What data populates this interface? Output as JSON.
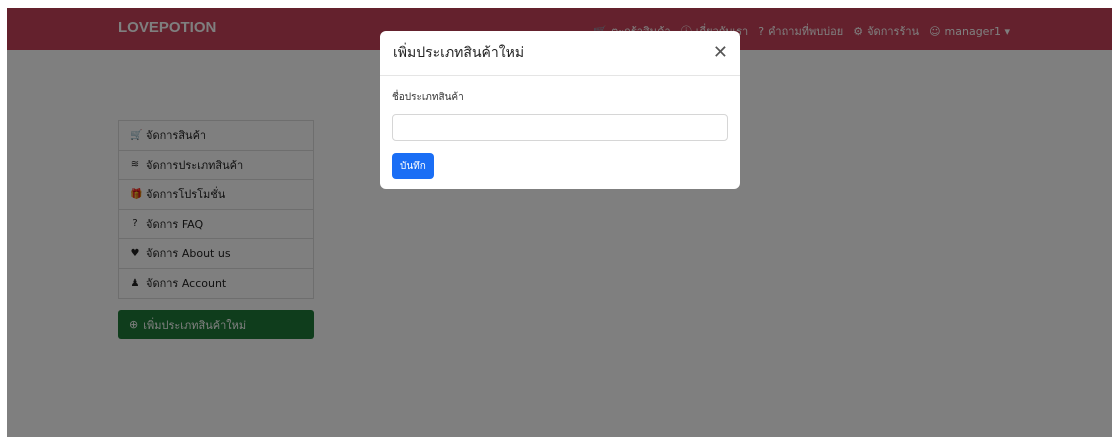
{
  "navbar": {
    "brand": "LOVEPOTION",
    "links": [
      {
        "icon": "cart-icon",
        "label": "ตะกร้าสินค้า"
      },
      {
        "icon": "info-icon",
        "label": "เกี่ยวกับเรา"
      },
      {
        "icon": "question-icon",
        "label": "คำถามที่พบบ่อย"
      },
      {
        "icon": "settings-icon",
        "label": "จัดการร้าน"
      },
      {
        "icon": "user-icon",
        "label": "manager1 ▾"
      }
    ]
  },
  "sidebar": {
    "items": [
      {
        "icon": "cart-icon",
        "label": "จัดการสินค้า"
      },
      {
        "icon": "layers-icon",
        "label": "จัดการประเภทสินค้า"
      },
      {
        "icon": "gift-icon",
        "label": "จัดการโปรโมชั่น"
      },
      {
        "icon": "question-circle-icon",
        "label": "จัดการ FAQ"
      },
      {
        "icon": "heart-icon",
        "label": "จัดการ About us"
      },
      {
        "icon": "user-icon",
        "label": "จัดการ Account"
      }
    ],
    "add_button": "เพิ่มประเภทสินค้าใหม่"
  },
  "modal": {
    "title": "เพิ่มประเภทสินค้าใหม่",
    "field_label": "ชื่อประเภทสินค้า",
    "field_value": "",
    "save_label": "บันทึก"
  },
  "colors": {
    "navbar": "#c8435a",
    "add_button": "#1f7a38",
    "save_button": "#1a6ef5"
  }
}
